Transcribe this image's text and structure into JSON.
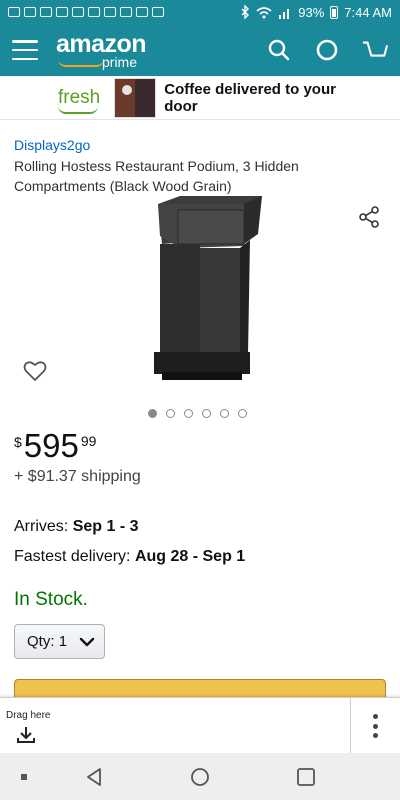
{
  "status_bar": {
    "battery": "93%",
    "time": "7:44 AM"
  },
  "header": {
    "logo_main": "amazon",
    "logo_sub": "prime"
  },
  "fresh_banner": {
    "logo": "fresh",
    "text": "Coffee delivered to your door"
  },
  "product": {
    "brand": "Displays2go",
    "title": "Rolling Hostess Restaurant Podium, 3 Hidden Compartments (Black Wood Grain)",
    "price_currency": "$",
    "price_whole": "595",
    "price_fraction": "99",
    "shipping": "+ $91.37 shipping",
    "arrives_label": "Arrives:",
    "arrives_value": "Sep 1 - 3",
    "fastest_label": "Fastest delivery:",
    "fastest_value": "Aug 28 - Sep 1",
    "stock": "In Stock.",
    "qty_label": "Qty:",
    "qty_value": "1"
  },
  "carousel": {
    "total": 6,
    "active": 1
  },
  "drag_panel": {
    "label": "Drag here"
  },
  "colors": {
    "header": "#1a8a9a",
    "link": "#0066c0",
    "stock": "#007600",
    "cart_button": "#f0c14b",
    "fresh": "#5aa12a"
  }
}
